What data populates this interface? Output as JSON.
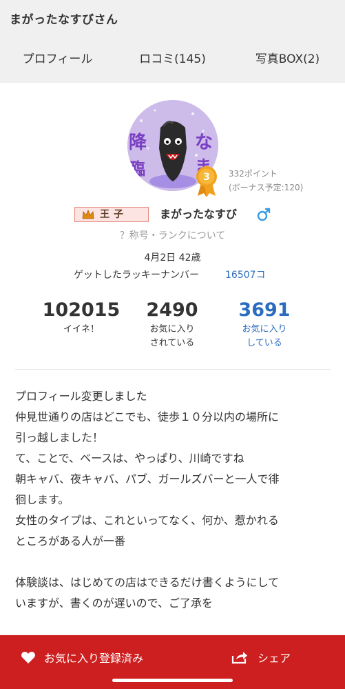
{
  "header": {
    "title": "まがったなすびさん"
  },
  "tabs": [
    {
      "label": "プロフィール",
      "active": true
    },
    {
      "label": "ロコミ(145)",
      "active": false
    },
    {
      "label": "写真BOX(2)",
      "active": false
    }
  ],
  "profile": {
    "rank_number": "3",
    "points": "332ポイント",
    "bonus": "(ボーナス予定:120)",
    "title_badge": "王子",
    "username": "まがったなすび",
    "rank_link": "？称号・ランクについて",
    "birth_age": "4月2日 42歳",
    "lucky_label": "ゲットしたラッキーナンバー",
    "lucky_value": "16507コ"
  },
  "stats": [
    {
      "value": "102015",
      "label": "イイネ！",
      "label2": ""
    },
    {
      "value": "2490",
      "label": "お気に入り",
      "label2": "されている"
    },
    {
      "value": "3691",
      "label": "お気に入り",
      "label2": "している"
    }
  ],
  "bio": {
    "lines": [
      "プロフィール変更しました",
      "仲見世通りの店はどこでも、徒歩１０分以内の場所に",
      "引っ越しました！",
      "て、ことで、ベースは、やっぱり、川崎ですね",
      "朝キャバ、夜キャバ、パブ、ガールズバーと一人で徘",
      "徊します。",
      "女性のタイプは、これといってなく、何か、惹かれる",
      "ところがある人が一番"
    ],
    "lines2": [
      "体験談は、はじめての店はできるだけ書くようにして",
      "いますが、書くのが遅いので、ご了承を"
    ]
  },
  "bottom": {
    "favorite_label": "お気に入り登録済み",
    "share_label": "シェア"
  },
  "colors": {
    "accent_red": "#cd1f1f",
    "link_blue": "#2b6cbf",
    "medal_orange": "#f0a21e"
  },
  "icons": {
    "favorite": "heart-icon",
    "share": "share-icon",
    "gender": "male-icon",
    "title": "crown-icon"
  }
}
